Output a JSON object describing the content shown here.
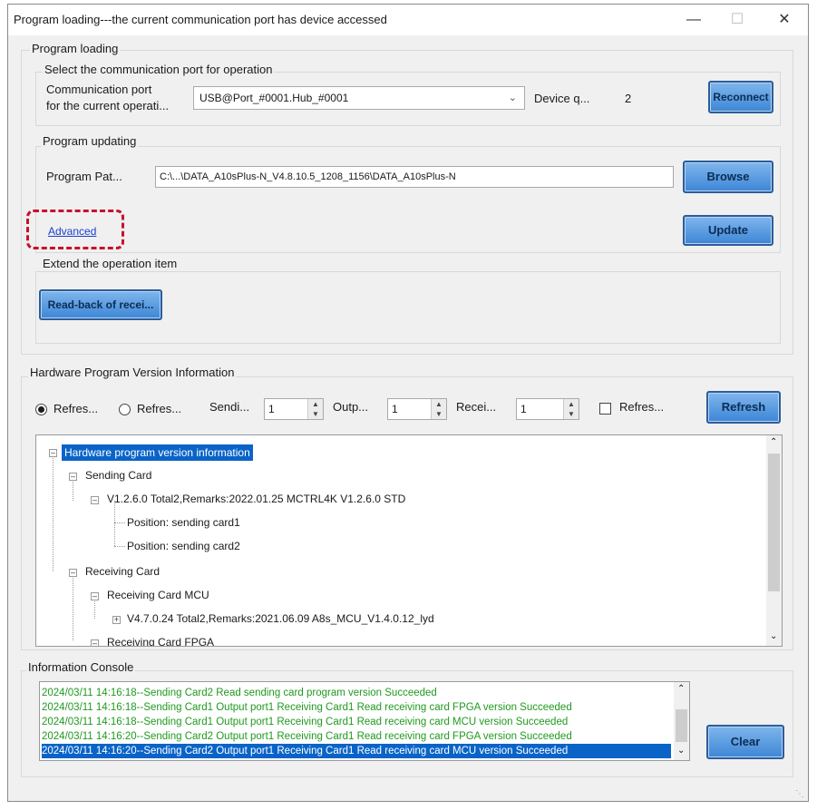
{
  "window": {
    "title": "Program loading---the current communication port has device accessed"
  },
  "program_loading": {
    "group_label": "Program loading",
    "select_port": {
      "group_label": "Select the communication port for operation",
      "port_label_line1": "Communication port",
      "port_label_line2": "for the current operati...",
      "port_value": "USB@Port_#0001.Hub_#0001",
      "device_label": "Device q...",
      "device_count": "2",
      "reconnect_label": "Reconnect"
    },
    "program_updating": {
      "group_label": "Program updating",
      "path_label": "Program Pat...",
      "path_value": "C:\\...\\DATA_A10sPlus-N_V4.8.10.5_1208_1156\\DATA_A10sPlus-N",
      "browse_label": "Browse",
      "advanced_label": "Advanced",
      "update_label": "Update"
    },
    "extend": {
      "group_label": "Extend the operation item",
      "readback_label": "Read-back of recei..."
    }
  },
  "hardware": {
    "group_label": "Hardware Program Version Information",
    "radio1_label": "Refres...",
    "radio2_label": "Refres...",
    "sending_label": "Sendi...",
    "sending_value": "1",
    "output_label": "Outp...",
    "output_value": "1",
    "receiving_label": "Recei...",
    "receiving_value": "1",
    "check_label": "Refres...",
    "refresh_label": "Refresh",
    "tree": {
      "root": "Hardware program version information",
      "sending_card": "Sending Card",
      "sending_version": "V1.2.6.0 Total2,Remarks:2022.01.25 MCTRL4K V1.2.6.0 STD",
      "position1": "Position: sending card1",
      "position2": "Position: sending card2",
      "receiving_card": "Receiving Card",
      "receiving_mcu": "Receiving Card MCU",
      "mcu_version": "V4.7.0.24 Total2,Remarks:2021.06.09  A8s_MCU_V1.4.0.12_lyd",
      "receiving_fpga": "Receiving Card FPGA"
    }
  },
  "console": {
    "group_label": "Information Console",
    "lines": [
      "2024/03/11 14:16:18--Sending Card2 Read sending card program version Succeeded",
      "2024/03/11 14:16:18--Sending Card1 Output port1 Receiving Card1 Read receiving card FPGA version Succeeded",
      "2024/03/11 14:16:18--Sending Card1 Output port1 Receiving Card1 Read receiving card MCU version Succeeded",
      "2024/03/11 14:16:20--Sending Card2 Output port1 Receiving Card1 Read receiving card FPGA version Succeeded",
      "2024/03/11 14:16:20--Sending Card2 Output port1 Receiving Card1 Read receiving card MCU version Succeeded"
    ],
    "clear_label": "Clear"
  }
}
